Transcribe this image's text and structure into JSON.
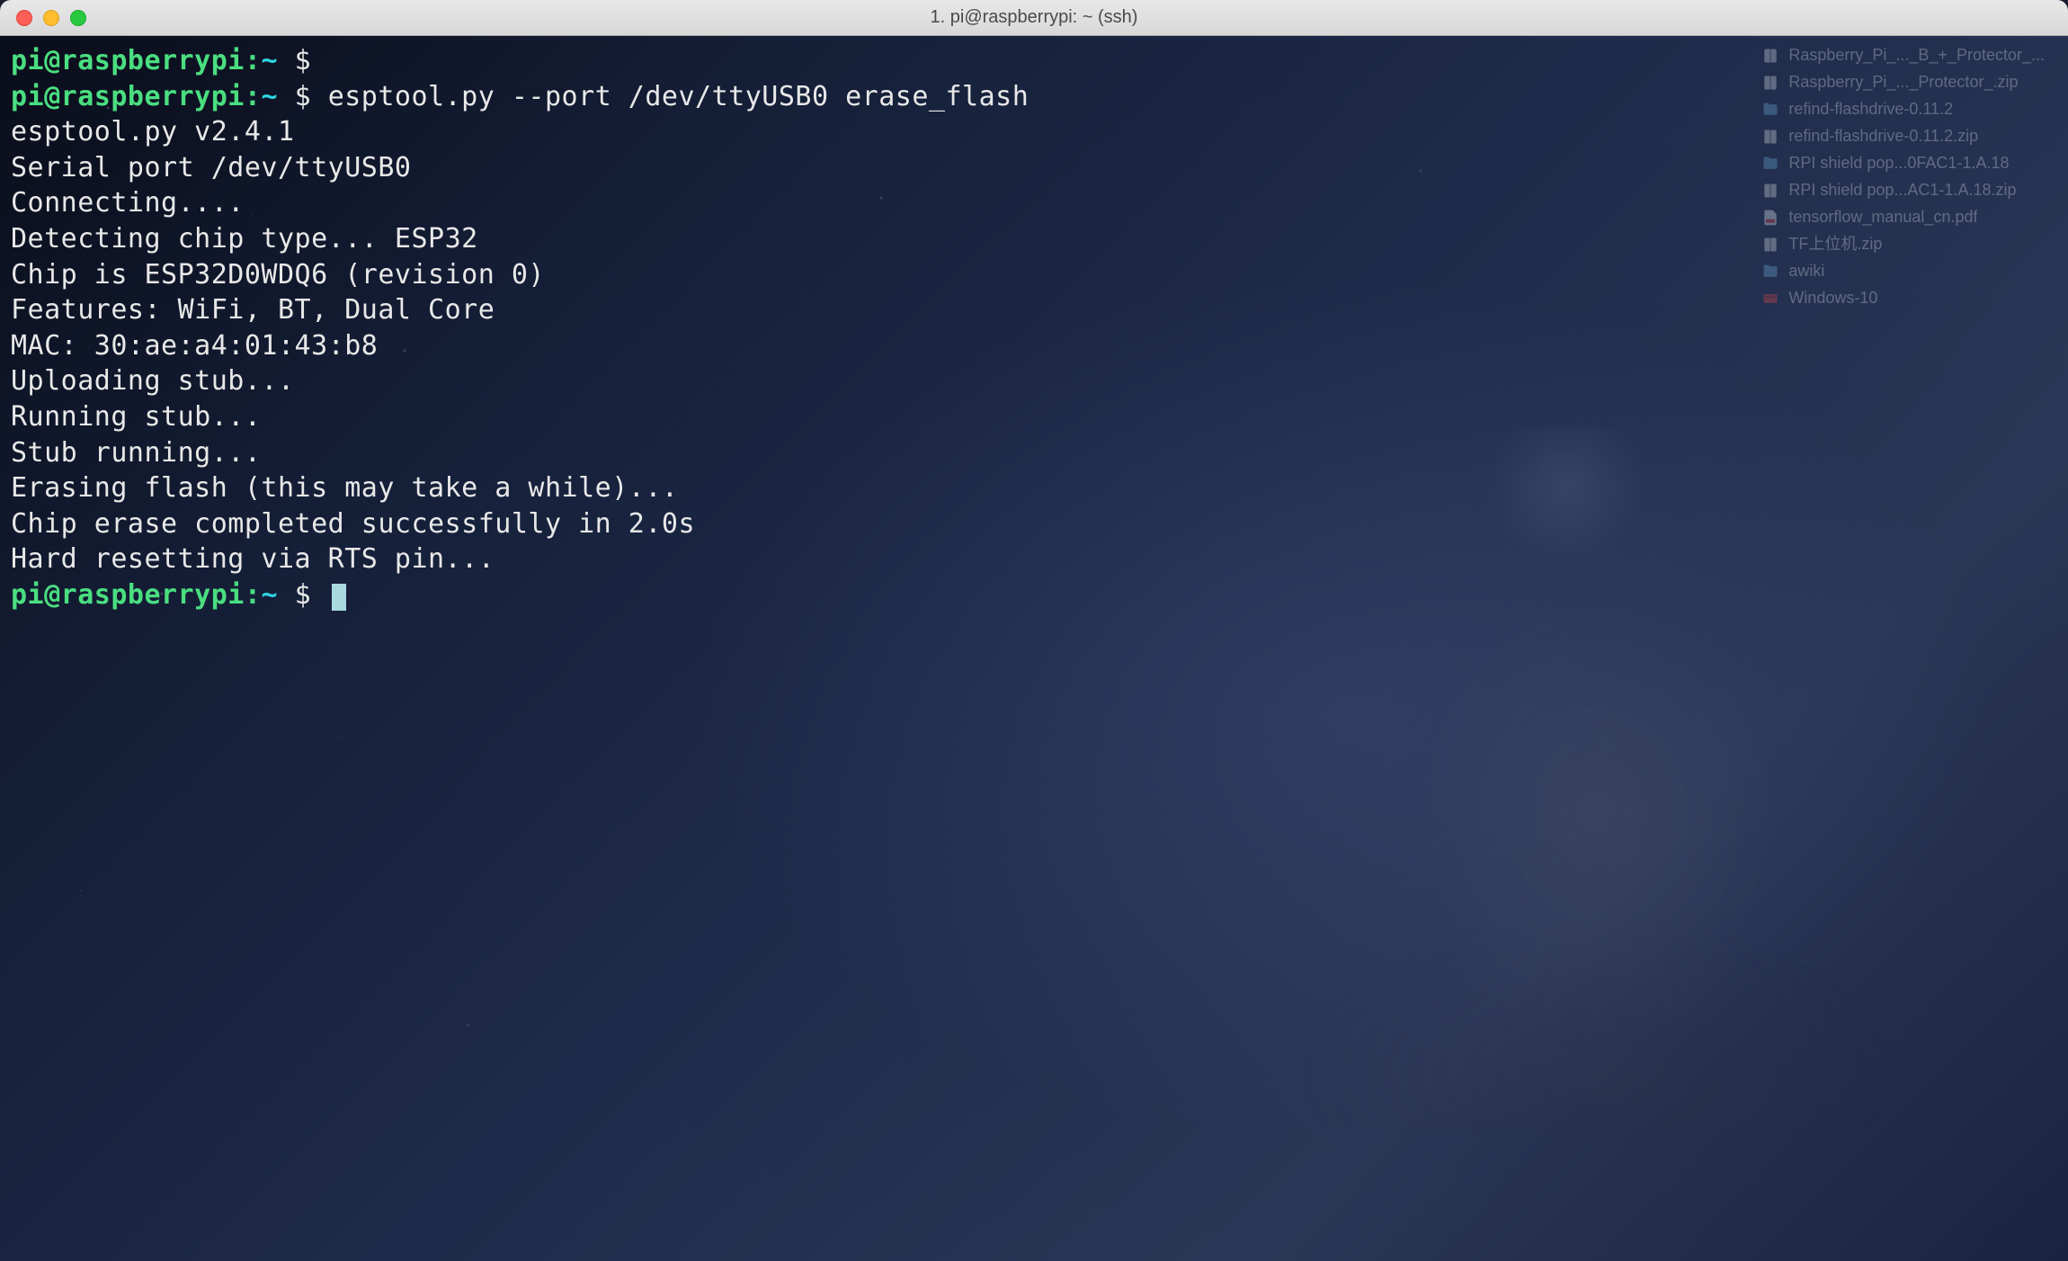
{
  "window": {
    "title": "1. pi@raspberrypi: ~ (ssh)"
  },
  "prompt": {
    "user_host": "pi@raspberrypi",
    "separator": ":",
    "path": "~",
    "symbol": "$"
  },
  "session": {
    "lines": [
      {
        "type": "prompt",
        "command": ""
      },
      {
        "type": "prompt",
        "command": "esptool.py --port /dev/ttyUSB0 erase_flash"
      },
      {
        "type": "output",
        "text": "esptool.py v2.4.1"
      },
      {
        "type": "output",
        "text": "Serial port /dev/ttyUSB0"
      },
      {
        "type": "output",
        "text": "Connecting...."
      },
      {
        "type": "output",
        "text": "Detecting chip type... ESP32"
      },
      {
        "type": "output",
        "text": "Chip is ESP32D0WDQ6 (revision 0)"
      },
      {
        "type": "output",
        "text": "Features: WiFi, BT, Dual Core"
      },
      {
        "type": "output",
        "text": "MAC: 30:ae:a4:01:43:b8"
      },
      {
        "type": "output",
        "text": "Uploading stub..."
      },
      {
        "type": "output",
        "text": "Running stub..."
      },
      {
        "type": "output",
        "text": "Stub running..."
      },
      {
        "type": "output",
        "text": "Erasing flash (this may take a while)..."
      },
      {
        "type": "output",
        "text": "Chip erase completed successfully in 2.0s"
      },
      {
        "type": "output",
        "text": "Hard resetting via RTS pin..."
      },
      {
        "type": "prompt",
        "command": "",
        "cursor": true
      }
    ]
  },
  "desktop": {
    "files": [
      {
        "icon": "archive",
        "label": "Raspberry_Pi_..._B_+_Protector_..."
      },
      {
        "icon": "archive",
        "label": "Raspberry_Pi_..._Protector_.zip"
      },
      {
        "icon": "folder",
        "label": "refind-flashdrive-0.11.2"
      },
      {
        "icon": "archive",
        "label": "refind-flashdrive-0.11.2.zip"
      },
      {
        "icon": "folder",
        "label": "RPI shield pop...0FAC1-1.A.18"
      },
      {
        "icon": "archive",
        "label": "RPI shield pop...AC1-1.A.18.zip"
      },
      {
        "icon": "pdf",
        "label": "tensorflow_manual_cn.pdf"
      },
      {
        "icon": "archive",
        "label": "TF上位机.zip"
      },
      {
        "icon": "folder",
        "label": "awiki"
      },
      {
        "icon": "disk",
        "label": "Windows-10"
      }
    ]
  }
}
